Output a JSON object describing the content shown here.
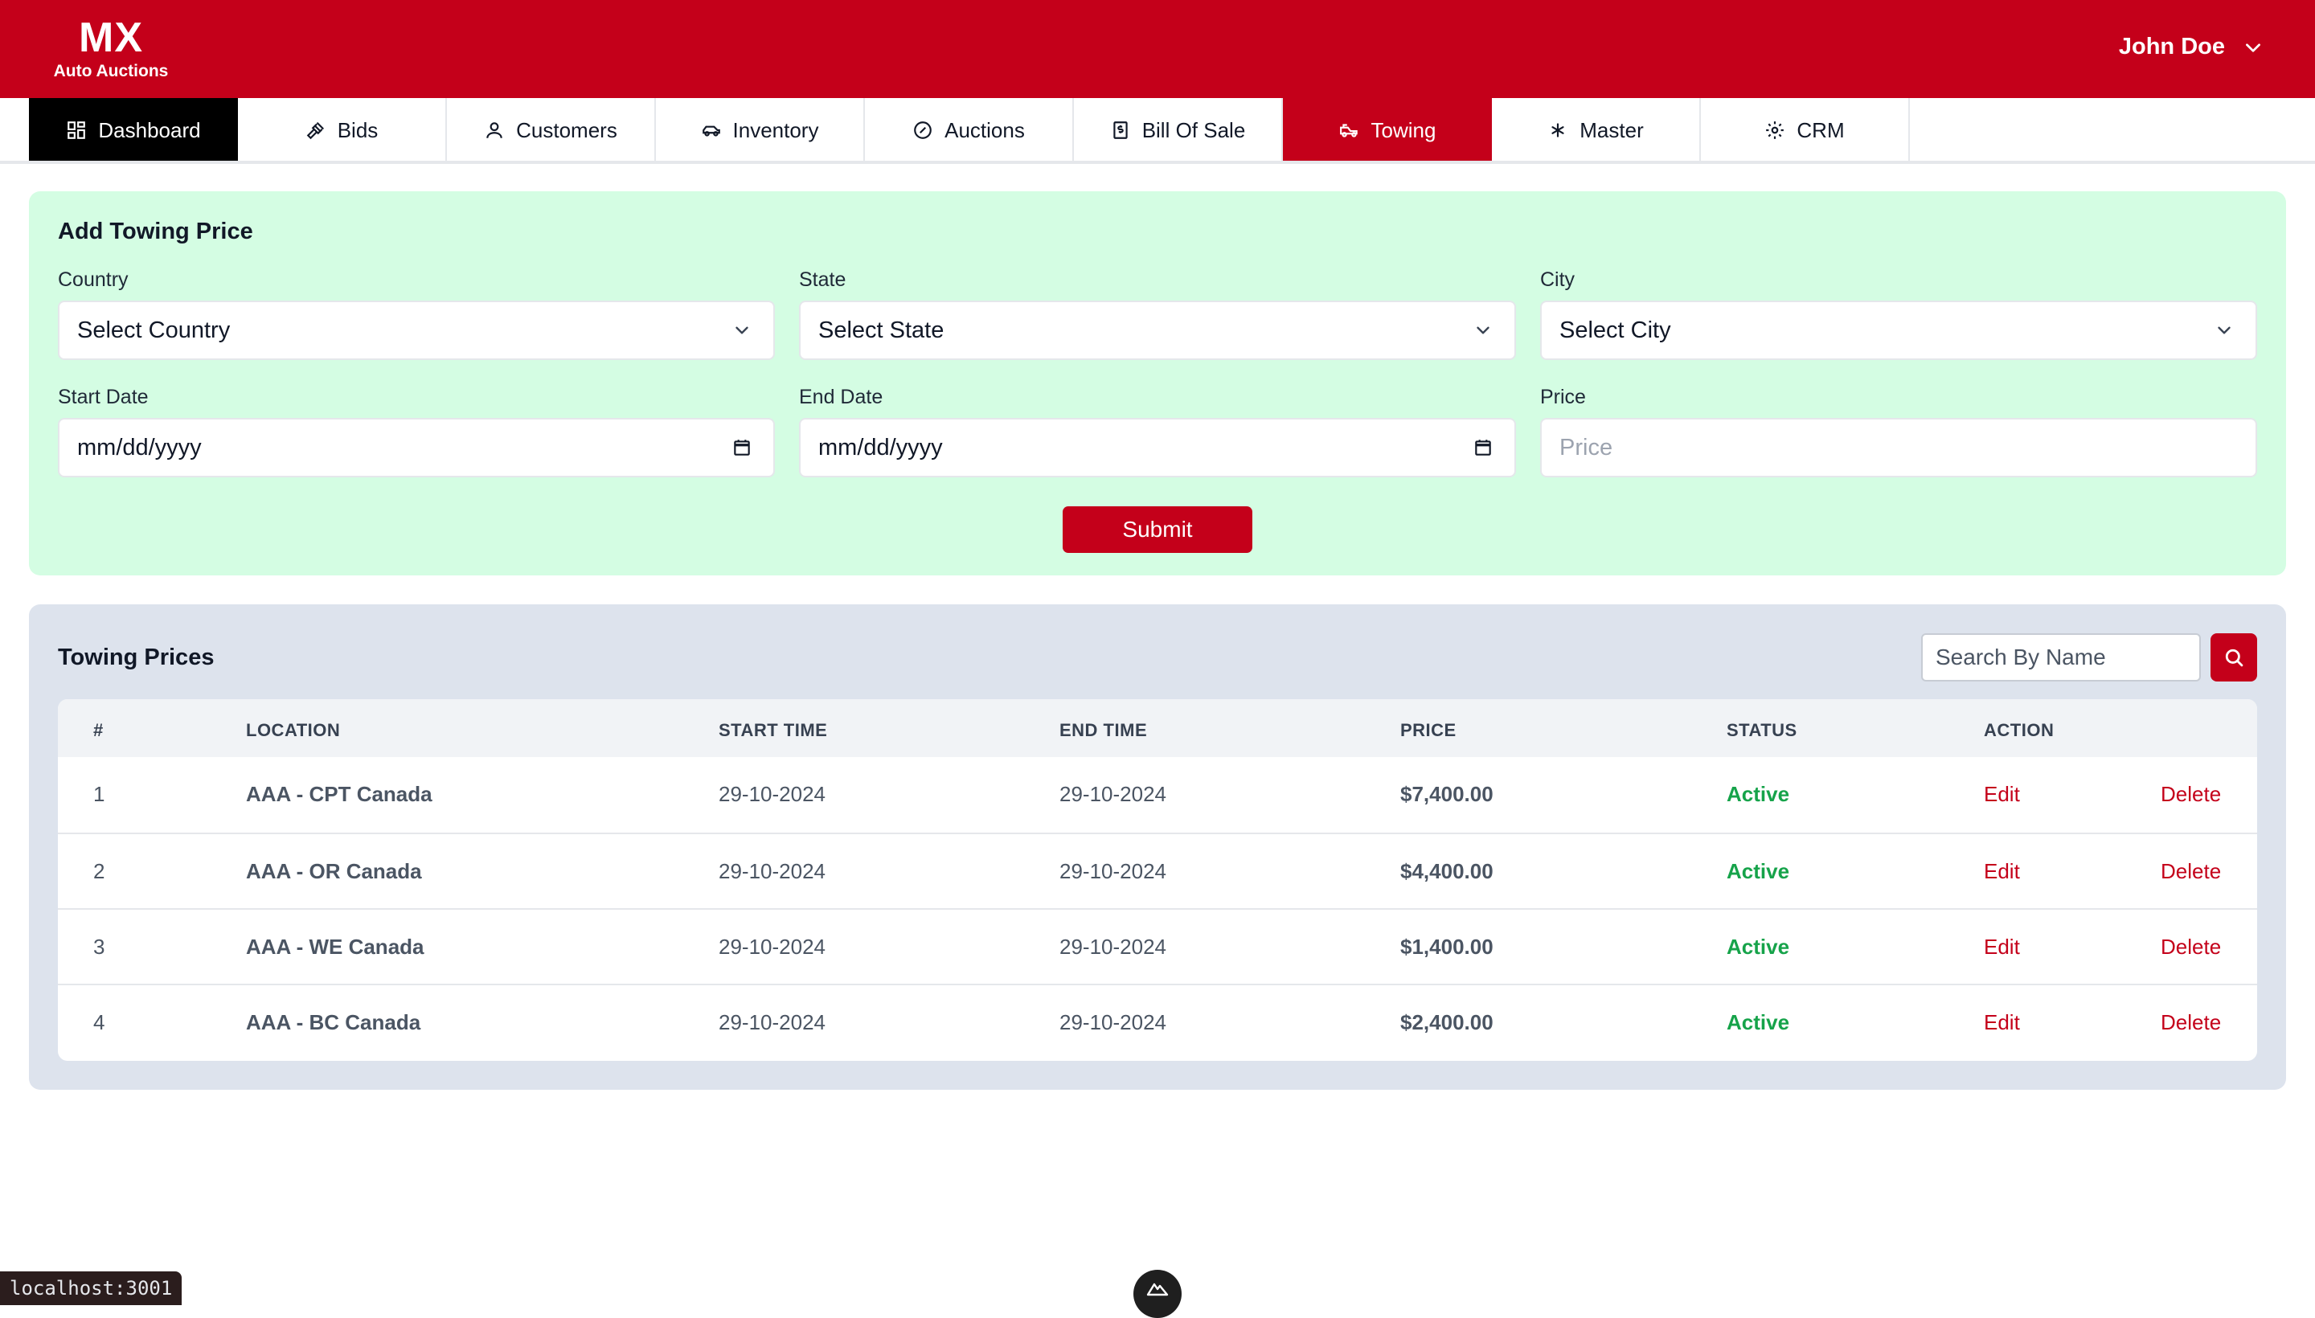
{
  "brand": {
    "name": "MX",
    "tagline": "Auto Auctions",
    "color": "#c4001a"
  },
  "user": {
    "name": "John Doe"
  },
  "nav": [
    {
      "label": "Dashboard",
      "icon": "grid-icon"
    },
    {
      "label": "Bids",
      "icon": "gavel-icon"
    },
    {
      "label": "Customers",
      "icon": "user-icon"
    },
    {
      "label": "Inventory",
      "icon": "car-icon"
    },
    {
      "label": "Auctions",
      "icon": "gauge-icon"
    },
    {
      "label": "Bill Of Sale",
      "icon": "receipt-icon"
    },
    {
      "label": "Towing",
      "icon": "tow-truck-icon"
    },
    {
      "label": "Master",
      "icon": "asterisk-icon"
    },
    {
      "label": "CRM",
      "icon": "gear-icon"
    }
  ],
  "add_form": {
    "title": "Add Towing Price",
    "country": {
      "label": "Country",
      "value": "Select Country"
    },
    "state": {
      "label": "State",
      "value": "Select State"
    },
    "city": {
      "label": "City",
      "value": "Select City"
    },
    "start_date": {
      "label": "Start Date",
      "value": "mm/dd/yyyy"
    },
    "end_date": {
      "label": "End Date",
      "value": "mm/dd/yyyy"
    },
    "price": {
      "label": "Price",
      "placeholder": "Price"
    },
    "submit_label": "Submit"
  },
  "prices": {
    "title": "Towing Prices",
    "search_placeholder": "Search By Name",
    "columns": [
      "#",
      "LOCATION",
      "START TIME",
      "END TIME",
      "PRICE",
      "STATUS",
      "ACTION"
    ],
    "rows": [
      {
        "num": "1",
        "location": "AAA - CPT Canada",
        "start": "29-10-2024",
        "end": "29-10-2024",
        "price": "$7,400.00",
        "status": "Active",
        "edit": "Edit",
        "delete": "Delete"
      },
      {
        "num": "2",
        "location": "AAA - OR Canada",
        "start": "29-10-2024",
        "end": "29-10-2024",
        "price": "$4,400.00",
        "status": "Active",
        "edit": "Edit",
        "delete": "Delete"
      },
      {
        "num": "3",
        "location": "AAA - WE Canada",
        "start": "29-10-2024",
        "end": "29-10-2024",
        "price": "$1,400.00",
        "status": "Active",
        "edit": "Edit",
        "delete": "Delete"
      },
      {
        "num": "4",
        "location": "AAA - BC Canada",
        "start": "29-10-2024",
        "end": "29-10-2024",
        "price": "$2,400.00",
        "status": "Active",
        "edit": "Edit",
        "delete": "Delete"
      }
    ]
  },
  "status_bar": {
    "url": "localhost:3001"
  }
}
